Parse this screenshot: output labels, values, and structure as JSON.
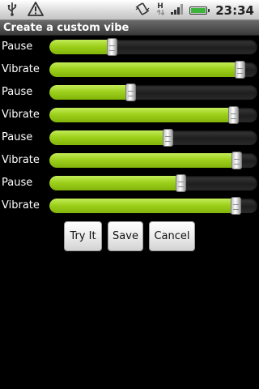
{
  "status_bar": {
    "time": "23:34",
    "icons": [
      "usb-icon",
      "warning-icon",
      "vibrate-mode-icon",
      "hspa-data-icon",
      "signal-icon",
      "battery-icon"
    ]
  },
  "title_bar": {
    "title": "Create a custom vibe"
  },
  "sliders": [
    {
      "label": "Pause",
      "value": 0.3
    },
    {
      "label": "Vibrate",
      "value": 0.915
    },
    {
      "label": "Pause",
      "value": 0.39
    },
    {
      "label": "Vibrate",
      "value": 0.885
    },
    {
      "label": "Pause",
      "value": 0.57
    },
    {
      "label": "Vibrate",
      "value": 0.9
    },
    {
      "label": "Pause",
      "value": 0.63
    },
    {
      "label": "Vibrate",
      "value": 0.895
    }
  ],
  "buttons": {
    "try_it": "Try It",
    "save": "Save",
    "cancel": "Cancel"
  },
  "colors": {
    "slider_fill": "#9ed11c",
    "track": "#2a2a2a",
    "background": "#000000"
  }
}
